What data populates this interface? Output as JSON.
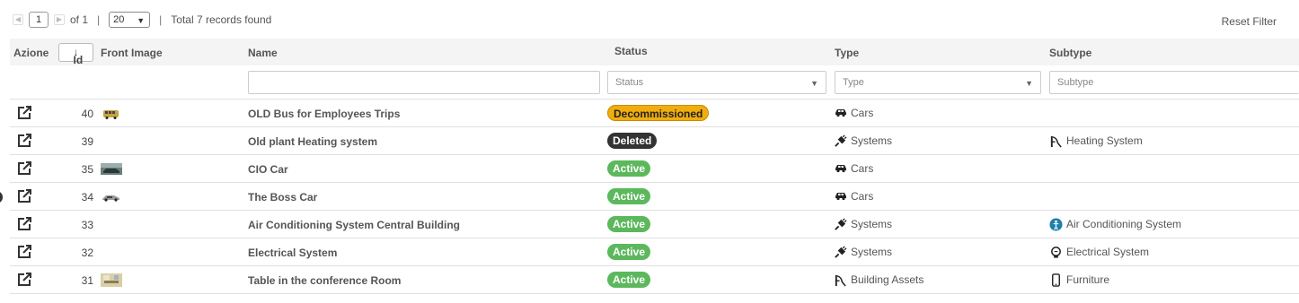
{
  "pager": {
    "page": "1",
    "of_label": "of 1",
    "sep": "|",
    "page_size": "20",
    "total": "Total 7 records found"
  },
  "reset_filter": "Reset Filter",
  "columns": {
    "action": "Azione",
    "id": "Id",
    "front_image": "Front Image",
    "name": "Name",
    "status": "Status",
    "type": "Type",
    "subtype": "Subtype"
  },
  "filters": {
    "name_value": "",
    "status_placeholder": "Status",
    "type_placeholder": "Type",
    "subtype_placeholder": "Subtype"
  },
  "colors": {
    "active": "#5cb85c",
    "deleted": "#333333",
    "decommissioned": "#f0ad0e"
  },
  "rows": [
    {
      "id": "40",
      "image": "yellow-bus-thumbnail",
      "name": "OLD Bus for Employees Trips",
      "status": "Decommissioned",
      "status_kind": "decommissioned",
      "type": "Cars",
      "type_icon": "car-icon",
      "subtype": "",
      "subtype_icon": ""
    },
    {
      "id": "39",
      "image": "",
      "name": "Old plant Heating system",
      "status": "Deleted",
      "status_kind": "deleted",
      "type": "Systems",
      "type_icon": "plug-icon",
      "subtype": "Heating System",
      "subtype_icon": "slide-icon"
    },
    {
      "id": "35",
      "image": "car-photo-thumbnail",
      "name": "CIO Car",
      "status": "Active",
      "status_kind": "active",
      "type": "Cars",
      "type_icon": "car-icon",
      "subtype": "",
      "subtype_icon": ""
    },
    {
      "id": "34",
      "image": "silver-car-thumbnail",
      "name": "The Boss Car",
      "status": "Active",
      "status_kind": "active",
      "type": "Cars",
      "type_icon": "car-icon",
      "subtype": "",
      "subtype_icon": ""
    },
    {
      "id": "33",
      "image": "",
      "name": "Air Conditioning System Central Building",
      "status": "Active",
      "status_kind": "active",
      "type": "Systems",
      "type_icon": "plug-icon",
      "subtype": "Air Conditioning System",
      "subtype_icon": "person-circle-icon"
    },
    {
      "id": "32",
      "image": "",
      "name": "Electrical System",
      "status": "Active",
      "status_kind": "active",
      "type": "Systems",
      "type_icon": "plug-icon",
      "subtype": "Electrical System",
      "subtype_icon": "lightbulb-icon"
    },
    {
      "id": "31",
      "image": "conference-table-thumbnail",
      "name": "Table in the conference Room",
      "status": "Active",
      "status_kind": "active",
      "type": "Building Assets",
      "type_icon": "slide-icon",
      "subtype": "Furniture",
      "subtype_icon": "phone-icon"
    }
  ]
}
